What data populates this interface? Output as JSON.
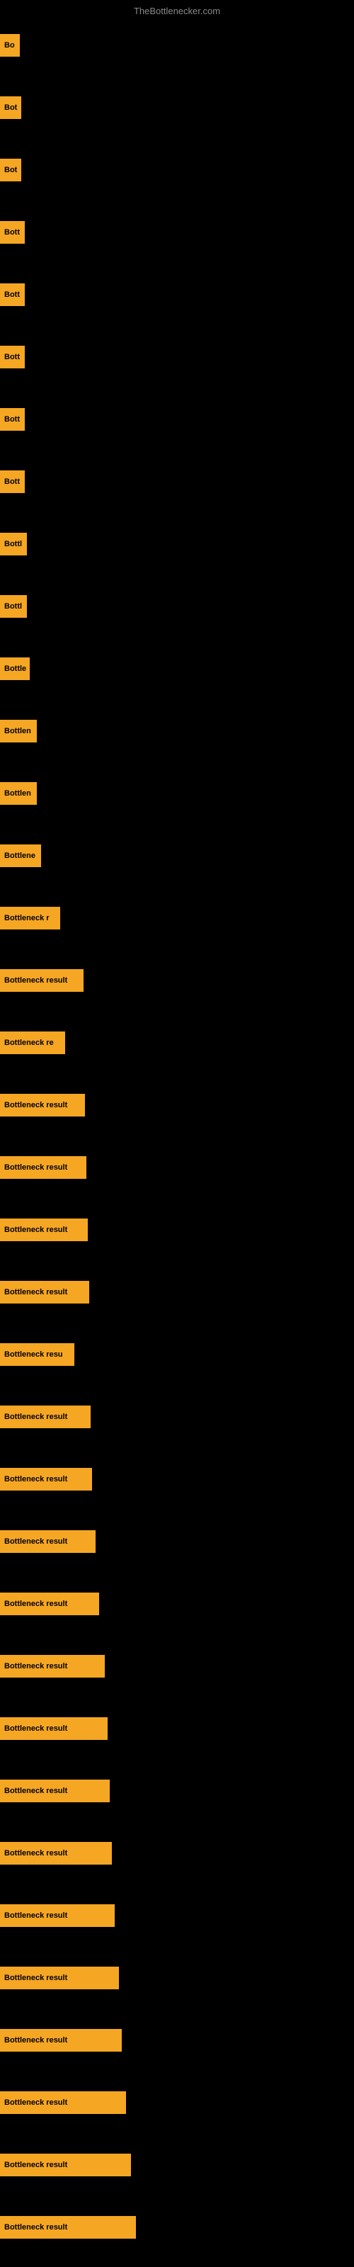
{
  "site": {
    "title": "TheBottlenecker.com"
  },
  "bars": [
    {
      "id": 1,
      "label": "Bo",
      "width": 28
    },
    {
      "id": 2,
      "label": "Bot",
      "width": 30
    },
    {
      "id": 3,
      "label": "Bot",
      "width": 30
    },
    {
      "id": 4,
      "label": "Bott",
      "width": 35
    },
    {
      "id": 5,
      "label": "Bott",
      "width": 35
    },
    {
      "id": 6,
      "label": "Bott",
      "width": 35
    },
    {
      "id": 7,
      "label": "Bott",
      "width": 35
    },
    {
      "id": 8,
      "label": "Bott",
      "width": 35
    },
    {
      "id": 9,
      "label": "Bottl",
      "width": 38
    },
    {
      "id": 10,
      "label": "Bottl",
      "width": 38
    },
    {
      "id": 11,
      "label": "Bottle",
      "width": 42
    },
    {
      "id": 12,
      "label": "Bottlen",
      "width": 52
    },
    {
      "id": 13,
      "label": "Bottlen",
      "width": 52
    },
    {
      "id": 14,
      "label": "Bottlene",
      "width": 58
    },
    {
      "id": 15,
      "label": "Bottleneck r",
      "width": 85
    },
    {
      "id": 16,
      "label": "Bottleneck result",
      "width": 118
    },
    {
      "id": 17,
      "label": "Bottleneck re",
      "width": 92
    },
    {
      "id": 18,
      "label": "Bottleneck result",
      "width": 120
    },
    {
      "id": 19,
      "label": "Bottleneck result",
      "width": 122
    },
    {
      "id": 20,
      "label": "Bottleneck result",
      "width": 124
    },
    {
      "id": 21,
      "label": "Bottleneck result",
      "width": 126
    },
    {
      "id": 22,
      "label": "Bottleneck resu",
      "width": 105
    },
    {
      "id": 23,
      "label": "Bottleneck result",
      "width": 128
    },
    {
      "id": 24,
      "label": "Bottleneck result",
      "width": 130
    },
    {
      "id": 25,
      "label": "Bottleneck result",
      "width": 135
    },
    {
      "id": 26,
      "label": "Bottleneck result",
      "width": 140
    },
    {
      "id": 27,
      "label": "Bottleneck result",
      "width": 148
    },
    {
      "id": 28,
      "label": "Bottleneck result",
      "width": 152
    },
    {
      "id": 29,
      "label": "Bottleneck result",
      "width": 155
    },
    {
      "id": 30,
      "label": "Bottleneck result",
      "width": 158
    },
    {
      "id": 31,
      "label": "Bottleneck result",
      "width": 162
    },
    {
      "id": 32,
      "label": "Bottleneck result",
      "width": 168
    },
    {
      "id": 33,
      "label": "Bottleneck result",
      "width": 172
    },
    {
      "id": 34,
      "label": "Bottleneck result",
      "width": 178
    },
    {
      "id": 35,
      "label": "Bottleneck result",
      "width": 185
    },
    {
      "id": 36,
      "label": "Bottleneck result",
      "width": 192
    }
  ]
}
